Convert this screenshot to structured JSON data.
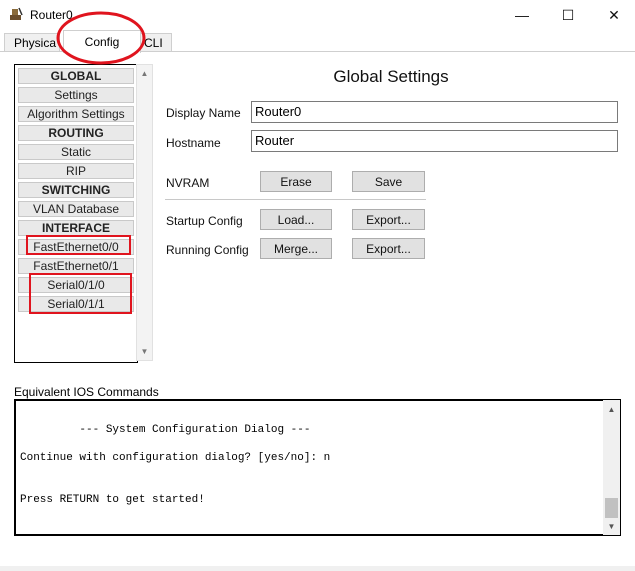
{
  "window": {
    "title": "Router0",
    "minimize_glyph": "—",
    "maximize_glyph": "☐",
    "close_glyph": "✕"
  },
  "tabs": [
    {
      "label": "Physical",
      "shown": "Physica"
    },
    {
      "label": "Config",
      "active": true
    },
    {
      "label": "CLI"
    }
  ],
  "nav": {
    "items": [
      {
        "label": "GLOBAL",
        "header": true
      },
      {
        "label": "Settings"
      },
      {
        "label": "Algorithm Settings"
      },
      {
        "label": "ROUTING",
        "header": true
      },
      {
        "label": "Static"
      },
      {
        "label": "RIP"
      },
      {
        "label": "SWITCHING",
        "header": true
      },
      {
        "label": "VLAN Database"
      },
      {
        "label": "INTERFACE",
        "header": true
      },
      {
        "label": "FastEthernet0/0",
        "highlighted": true
      },
      {
        "label": "FastEthernet0/1"
      },
      {
        "label": "Serial0/1/0",
        "highlighted": true
      },
      {
        "label": "Serial0/1/1",
        "highlighted": true
      }
    ]
  },
  "global_settings": {
    "title": "Global Settings",
    "display_name_label": "Display Name",
    "display_name_value": "Router0",
    "hostname_label": "Hostname",
    "hostname_value": "Router",
    "nvram_label": "NVRAM",
    "erase_label": "Erase",
    "save_label": "Save",
    "startup_label": "Startup Config",
    "load_label": "Load...",
    "export_label": "Export...",
    "running_label": "Running Config",
    "merge_label": "Merge...",
    "export2_label": "Export..."
  },
  "ios": {
    "label": "Equivalent IOS Commands",
    "lines": [
      "         --- System Configuration Dialog ---",
      "Continue with configuration dialog? [yes/no]: n",
      "Press RETURN to get started!"
    ]
  },
  "colors": {
    "annotation_red": "#e0141e"
  },
  "icons": {
    "app": "router-app-icon",
    "scroll_up": "scroll-up-icon",
    "scroll_down": "scroll-down-icon"
  }
}
